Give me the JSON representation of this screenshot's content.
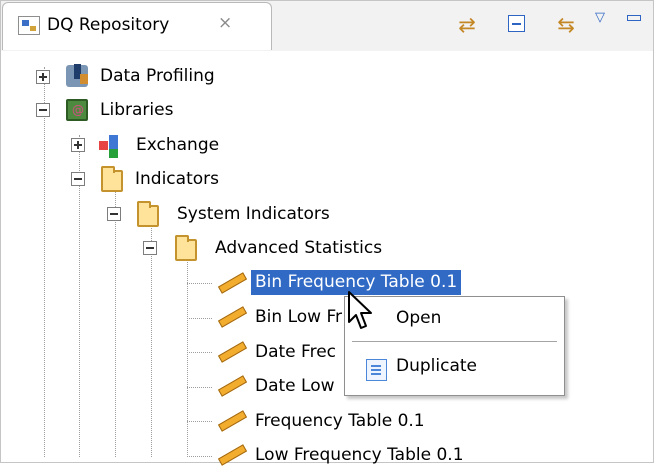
{
  "window": {
    "title": "DQ Repository",
    "close_symbol": "×",
    "toolbar": {
      "sync_icon": "sync-icon",
      "collapse_icon": "collapse-all-icon",
      "link_icon": "link-with-editor-icon",
      "menu_icon": "view-menu-icon",
      "minimize_icon": "minimize-icon"
    }
  },
  "tree": {
    "items": [
      {
        "label": "Data Profiling",
        "icon": "data-profiling-icon",
        "expanded": false
      },
      {
        "label": "Libraries",
        "icon": "libraries-icon",
        "expanded": true
      },
      {
        "label": "Exchange",
        "icon": "exchange-icon",
        "expanded": false
      },
      {
        "label": "Indicators",
        "icon": "folder-icon",
        "expanded": true
      },
      {
        "label": "System Indicators",
        "icon": "folder-icon",
        "expanded": true
      },
      {
        "label": "Advanced Statistics",
        "icon": "folder-icon",
        "expanded": true
      },
      {
        "label": "Bin Frequency Table 0.1",
        "icon": "indicator-icon",
        "selected": true
      },
      {
        "label": "Bin Low Fr",
        "icon": "indicator-icon"
      },
      {
        "label": "Date Frec",
        "icon": "indicator-icon"
      },
      {
        "label": "Date Low",
        "icon": "indicator-icon"
      },
      {
        "label": "Frequency Table 0.1",
        "icon": "indicator-icon"
      },
      {
        "label": "Low Frequency Table 0.1",
        "icon": "indicator-icon"
      }
    ]
  },
  "context_menu": {
    "items": [
      {
        "label": "Open"
      },
      {
        "label": "Duplicate",
        "icon": "duplicate-icon"
      }
    ]
  },
  "colors": {
    "selection": "#316ac5",
    "tree_line": "#9d9d9d",
    "toolbar_accent": "#2f65c2"
  }
}
